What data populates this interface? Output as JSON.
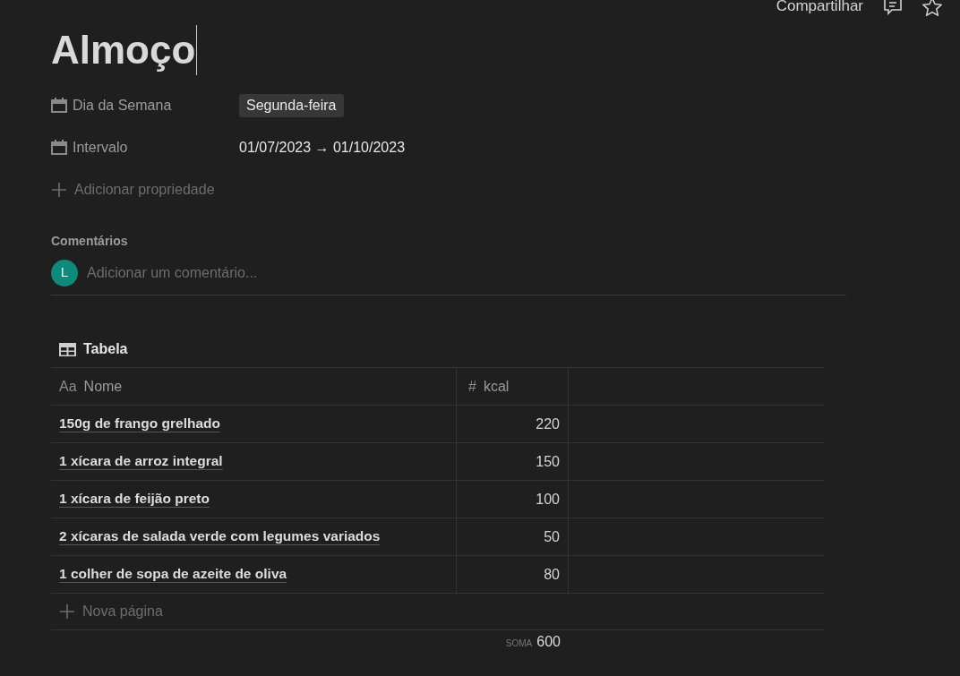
{
  "topbar": {
    "share": "Compartilhar"
  },
  "title": "Almoço",
  "properties": [
    {
      "kind": "tag",
      "label": "Dia da Semana",
      "value": "Segunda-feira"
    },
    {
      "kind": "date",
      "label": "Intervalo",
      "value": "01/07/2023 → 01/10/2023"
    }
  ],
  "add_property": "Adicionar propriedade",
  "comments": {
    "heading": "Comentários",
    "avatar": "L",
    "placeholder": "Adicionar um comentário..."
  },
  "table": {
    "title": "Tabela",
    "columns": [
      {
        "icon": "Aa",
        "label": "Nome"
      },
      {
        "icon": "#",
        "label": "kcal"
      }
    ],
    "rows": [
      {
        "name": "150g de frango grelhado",
        "kcal": "220"
      },
      {
        "name": "1 xícara de arroz integral",
        "kcal": "150"
      },
      {
        "name": "1 xícara de feijão preto",
        "kcal": "100"
      },
      {
        "name": "2 xícaras de salada verde com legumes variados",
        "kcal": "50"
      },
      {
        "name": "1 colher de sopa de azeite de oliva",
        "kcal": "80"
      }
    ],
    "new_page": "Nova página",
    "footer": {
      "label": "SOMA",
      "value": "600"
    }
  }
}
